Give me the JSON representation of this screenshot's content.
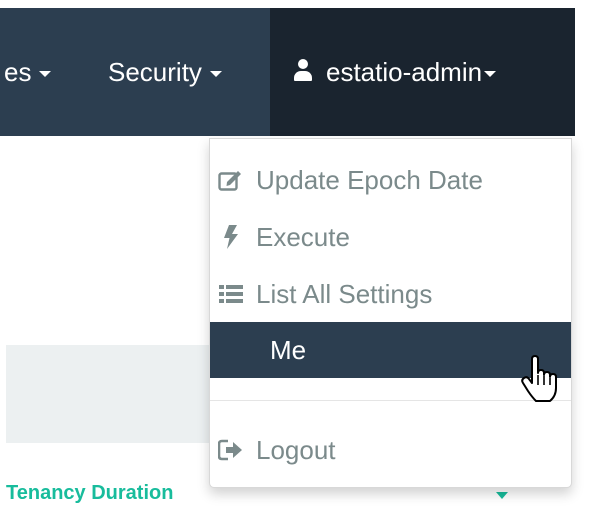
{
  "navbar": {
    "items": [
      {
        "label": "es"
      },
      {
        "label": "Security"
      },
      {
        "label": "estatio-admin"
      }
    ]
  },
  "dropdown": {
    "items": [
      {
        "label": "Update Epoch Date",
        "icon": "edit-icon"
      },
      {
        "label": "Execute",
        "icon": "bolt-icon"
      },
      {
        "label": "List All Settings",
        "icon": "list-icon"
      },
      {
        "label": "Me",
        "icon": "none",
        "active": true
      },
      {
        "label": "Logout",
        "icon": "sign-out-icon"
      }
    ]
  },
  "content": {
    "column_header": "Tenancy Duration"
  },
  "colors": {
    "navbar_bg": "#2c3e50",
    "navbar_active_bg": "#1a242f",
    "menu_text": "#7b8a8b",
    "menu_active_bg": "#2c3e50",
    "accent_teal": "#18bc9c",
    "panel_bg": "#ecf0f1"
  }
}
